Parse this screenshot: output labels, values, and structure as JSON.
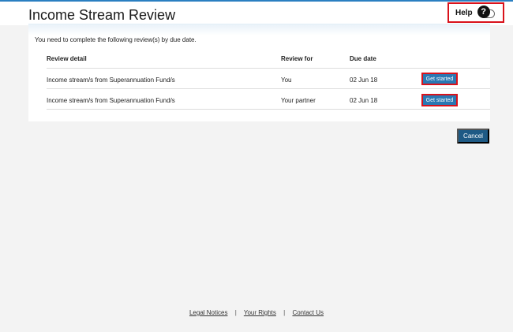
{
  "page": {
    "title": "Income Stream Review"
  },
  "help": {
    "label": "Help",
    "icon_glyph": "?"
  },
  "panel": {
    "intro": "You need to complete the following review(s) by due date.",
    "columns": [
      "Review detail",
      "Review for",
      "Due date"
    ],
    "rows": [
      {
        "detail": "Income stream/s from Superannuation Fund/s",
        "review_for": "You",
        "due_date": "02 Jun 18",
        "action": "Get started"
      },
      {
        "detail": "Income stream/s from Superannuation Fund/s",
        "review_for": "Your partner",
        "due_date": "02 Jun 18",
        "action": "Get started"
      }
    ]
  },
  "actions": {
    "cancel_label": "Cancel"
  },
  "footer": {
    "links": [
      "Legal Notices",
      "Your Rights",
      "Contact Us"
    ],
    "separator": "|"
  },
  "colors": {
    "accent_bar": "#2a7fc1",
    "primary_button": "#2b78b3",
    "cancel_button": "#1e5a85",
    "highlight": "#d9121b"
  }
}
